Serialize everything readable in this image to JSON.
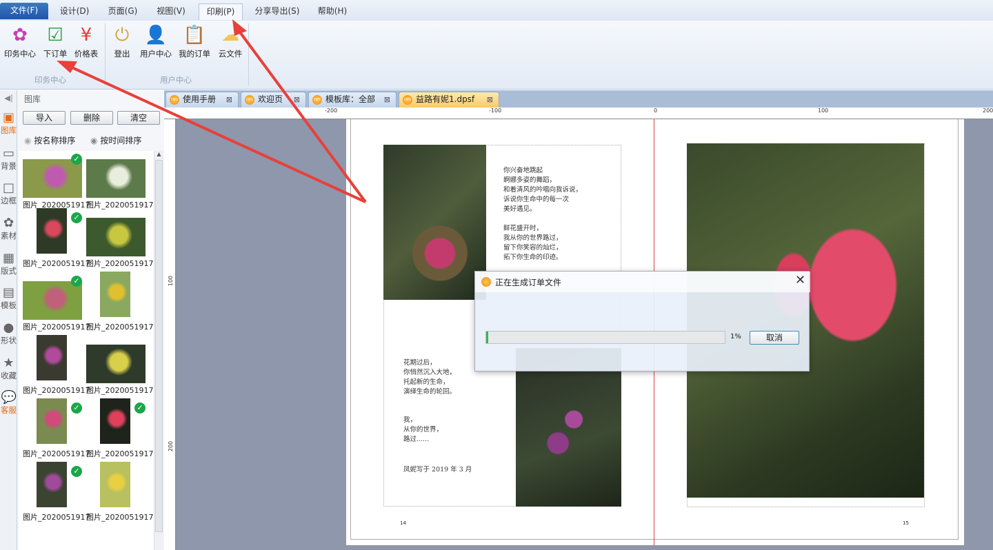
{
  "menu": [
    "文件(F)",
    "设计(D)",
    "页面(G)",
    "视图(V)",
    "印刷(P)",
    "分享导出(S)",
    "帮助(H)"
  ],
  "ribbon": {
    "print_group": {
      "label": "印务中心",
      "buttons": [
        "印务中心",
        "下订单",
        "价格表"
      ]
    },
    "user_group": {
      "label": "用户中心",
      "buttons": [
        "登出",
        "用户中心",
        "我的订单",
        "云文件"
      ]
    }
  },
  "strip": [
    "图库",
    "背景",
    "边框",
    "素材",
    "版式",
    "模板",
    "形状",
    "收藏",
    "客服"
  ],
  "library": {
    "title": "图库",
    "import": "导入",
    "delete": "删除",
    "clear": "清空",
    "sort_name": "按名称排序",
    "sort_time": "按时间排序",
    "items": [
      {
        "name": "图片_2020051917",
        "checked": true
      },
      {
        "name": "图片_2020051917",
        "checked": false
      },
      {
        "name": "图片_2020051917",
        "checked": true
      },
      {
        "name": "图片_2020051917",
        "checked": false
      },
      {
        "name": "图片_2020051917",
        "checked": true
      },
      {
        "name": "图片_2020051917",
        "checked": false
      },
      {
        "name": "图片_2020051917",
        "checked": false
      },
      {
        "name": "图片_2020051917",
        "checked": false
      },
      {
        "name": "图片_2020051917",
        "checked": true
      },
      {
        "name": "图片_2020051917",
        "checked": true
      },
      {
        "name": "图片_2020051917",
        "checked": true
      },
      {
        "name": "图片_2020051917",
        "checked": false
      }
    ]
  },
  "tabs": [
    "使用手册",
    "欢迎页",
    "模板库：全部",
    "益路有妮1.dpsf"
  ],
  "ruler": {
    "h": [
      "-200",
      "-100",
      "0",
      "100",
      "200"
    ],
    "v": [
      "100",
      "200"
    ]
  },
  "page": {
    "poem1": "你兴奋地跳起\n婀娜多姿的舞蹈，\n和着清风的吟唱向我诉说，\n诉说你生命中的每一次\n美好遇见。\n\n鲜花盛开时，\n我从你的世界路过，\n留下你笑容的灿烂，\n拓下你生命的印迹。",
    "poem2": "花期过后，\n你悄然沉入大地，\n托起新的生命，\n演绎生命的轮回。",
    "poem3": "我，\n从你的世界，\n路过......",
    "sign": "凤妮写于 2019 年 3 月",
    "left_num": "14",
    "right_num": "15"
  },
  "dialog": {
    "title": "正在生成订单文件",
    "progress": 1,
    "percent": "1%",
    "cancel": "取消"
  },
  "colors": {
    "accent": "#1f56a8",
    "arrow": "#e8403a",
    "progress": "#3cb44b"
  }
}
